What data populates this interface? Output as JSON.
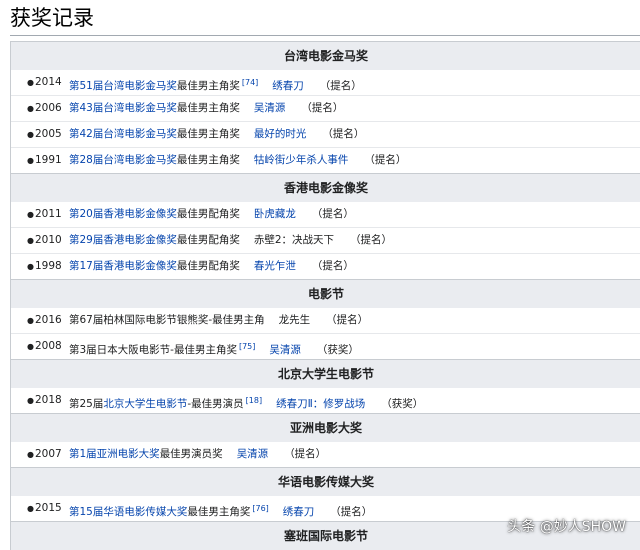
{
  "page": {
    "title": "获奖记录"
  },
  "groups": [
    {
      "title": "台湾电影金马奖",
      "rows": [
        {
          "year": "2014",
          "link": "第51届台湾电影金马奖",
          "suffix": "最佳男主角奖",
          "ref": "[74]",
          "work": "绣春刀",
          "work_link": true,
          "note": "（提名）"
        },
        {
          "year": "2006",
          "link": "第43届台湾电影金马奖",
          "suffix": "最佳男主角奖",
          "ref": "",
          "work": "吴清源",
          "work_link": true,
          "note": "（提名）"
        },
        {
          "year": "2005",
          "link": "第42届台湾电影金马奖",
          "suffix": "最佳男主角奖",
          "ref": "",
          "work": "最好的时光",
          "work_link": true,
          "note": "（提名）"
        },
        {
          "year": "1991",
          "link": "第28届台湾电影金马奖",
          "suffix": "最佳男主角奖",
          "ref": "",
          "work": "牯岭街少年杀人事件",
          "work_link": true,
          "note": "（提名）"
        }
      ]
    },
    {
      "title": "香港电影金像奖",
      "rows": [
        {
          "year": "2011",
          "link": "第20届香港电影金像奖",
          "suffix": "最佳男配角奖",
          "ref": "",
          "work": "卧虎藏龙",
          "work_link": true,
          "note": "（提名）"
        },
        {
          "year": "2010",
          "link": "第29届香港电影金像奖",
          "suffix": "最佳男配角奖",
          "ref": "",
          "work": "赤壁2：决战天下",
          "work_link": false,
          "note": "（提名）"
        },
        {
          "year": "1998",
          "link": "第17届香港电影金像奖",
          "suffix": "最佳男配角奖",
          "ref": "",
          "work": "春光乍泄",
          "work_link": true,
          "note": "（提名）"
        }
      ]
    },
    {
      "title": "电影节",
      "rows": [
        {
          "year": "2016",
          "prefix": "第67届柏林国际电影节银熊奖-最佳男主角",
          "link": "",
          "suffix": "",
          "ref": "",
          "work": "龙先生",
          "work_link": false,
          "note": "（提名）"
        },
        {
          "year": "2008",
          "prefix": "第3届日本大阪电影节-最佳男主角奖",
          "link": "",
          "suffix": "",
          "ref": "[75]",
          "work": "吴清源",
          "work_link": true,
          "note": "（获奖）"
        }
      ]
    },
    {
      "title": "北京大学生电影节",
      "rows": [
        {
          "year": "2018",
          "prefix": "第25届",
          "link": "北京大学生电影节",
          "suffix": "-最佳男演员",
          "ref": "[18]",
          "work": "绣春刀Ⅱ：修罗战场",
          "work_link": true,
          "note": "（获奖）"
        }
      ]
    },
    {
      "title": "亚洲电影大奖",
      "rows": [
        {
          "year": "2007",
          "link": "第1届亚洲电影大奖",
          "suffix": "最佳男演员奖",
          "ref": "",
          "work": "吴清源",
          "work_link": true,
          "note": "（提名）"
        }
      ]
    },
    {
      "title": "华语电影传媒大奖",
      "rows": [
        {
          "year": "2015",
          "link": "第15届华语电影传媒大奖",
          "suffix": "最佳男主角奖",
          "ref": "[76]",
          "work": "绣春刀",
          "work_link": true,
          "note": "（提名）"
        }
      ]
    },
    {
      "title": "塞班国际电影节",
      "rows": []
    }
  ],
  "watermark": "头条 @妙人SHOW",
  "colors": {
    "link": "#0645ad",
    "header_bg": "#eaecf0",
    "border": "#c8ccd1"
  }
}
